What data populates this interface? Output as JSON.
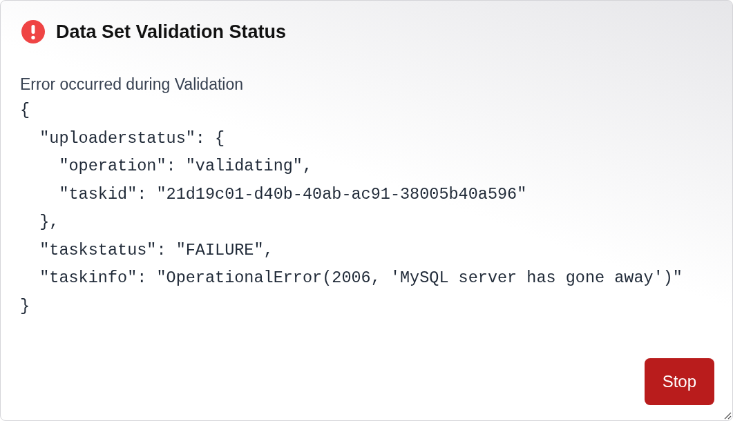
{
  "dialog": {
    "title": "Data Set Validation Status",
    "message": "Error occurred during Validation",
    "details": [
      "{",
      "  \"uploaderstatus\": {",
      "    \"operation\": \"validating\",",
      "    \"taskid\": \"21d19c01-d40b-40ab-ac91-38005b40a596\"",
      "  },",
      "  \"taskstatus\": \"FAILURE\",",
      "  \"taskinfo\": \"OperationalError(2006, 'MySQL server has gone away')\"",
      "}"
    ],
    "buttons": [
      {
        "label": "Stop",
        "kind": "danger"
      }
    ]
  }
}
